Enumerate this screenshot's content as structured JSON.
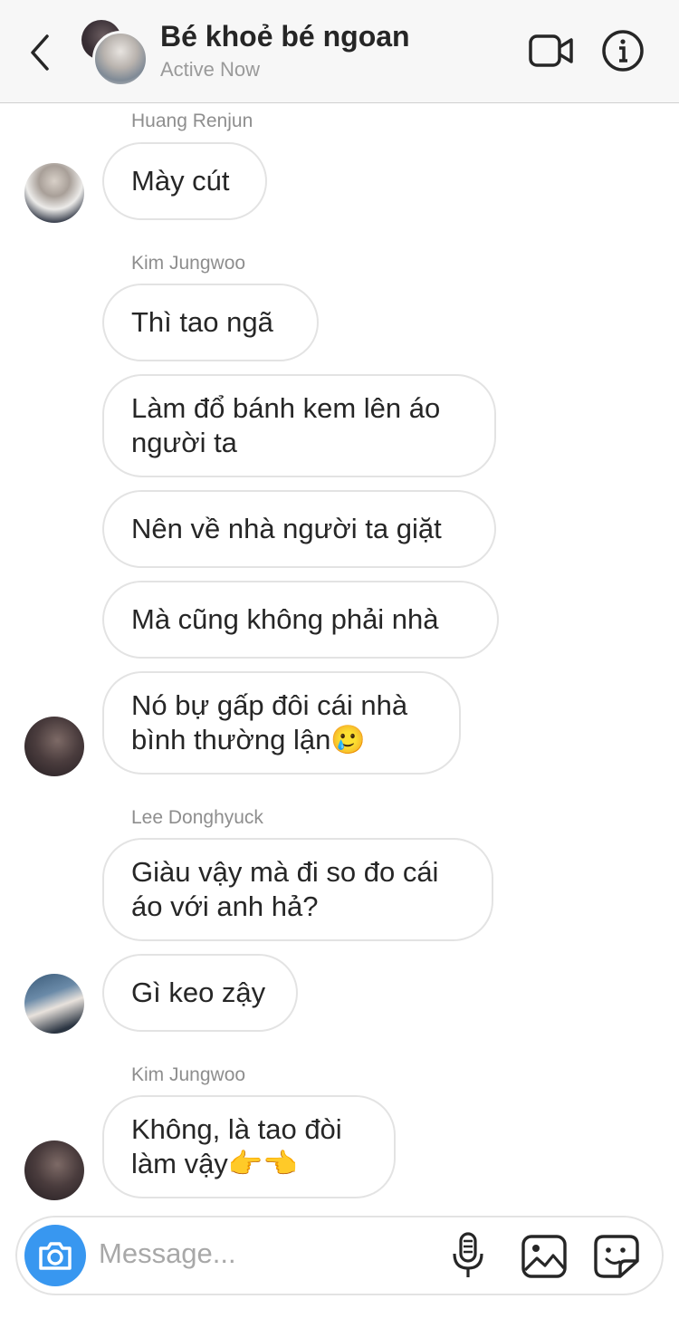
{
  "header": {
    "title": "Bé khoẻ bé ngoan",
    "status": "Active Now"
  },
  "messages": [
    {
      "sender": "Huang Renjun",
      "bubbles": [
        "Mày cút"
      ]
    },
    {
      "sender": "Kim Jungwoo",
      "bubbles": [
        "Thì tao ngã",
        "Làm đổ bánh kem lên áo người ta",
        "Nên về nhà người ta giặt",
        "Mà cũng không phải nhà",
        "Nó bự gấp đôi cái nhà bình thường lận🥲"
      ]
    },
    {
      "sender": "Lee Donghyuck",
      "bubbles": [
        "Giàu vậy mà đi so đo cái áo với anh hả?",
        "Gì keo zậy"
      ]
    },
    {
      "sender": "Kim Jungwoo",
      "bubbles": [
        "Không, là tao đòi làm vậy👉👈"
      ]
    }
  ],
  "composer": {
    "placeholder": "Message..."
  },
  "icons": {
    "back": "chevron-left-icon",
    "video": "video-camera-icon",
    "info": "info-icon",
    "camera": "camera-icon",
    "mic": "microphone-icon",
    "gallery": "gallery-icon",
    "sticker": "sticker-icon"
  },
  "colors": {
    "accent": "#3897f0",
    "bubble_border": "#e3e3e3",
    "header_bg": "#f7f7f7"
  }
}
